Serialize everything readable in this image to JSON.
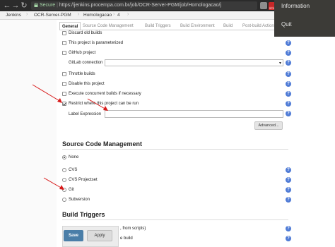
{
  "browser": {
    "secure_label": "Secure",
    "url_rest": "https://jenkins.procempa.com.br/job/OCR-Server-PGM/job/Homologacao/j",
    "ext_badge": "575"
  },
  "popup": {
    "items": [
      "Information",
      "Quit"
    ]
  },
  "breadcrumb": {
    "items": [
      "Jenkins",
      "OCR-Server-PGM",
      "Homologacao",
      "4"
    ]
  },
  "tabs": [
    "General",
    "Source Code Management",
    "Build Triggers",
    "Build Environment",
    "Build",
    "Post-build Actions"
  ],
  "general": {
    "discard_old_builds": "Discard old builds",
    "parameterized": "This project is parameterized",
    "github_project": "GitHub project",
    "gitlab_connection": "GitLab connection",
    "throttle_builds": "Throttle builds",
    "disable_project": "Disable this project",
    "concurrent_builds": "Execute concurrent builds if necessary",
    "restrict": "Restrict where this project can be run",
    "label_expression": "Label Expression",
    "advanced_button": "Advanced..."
  },
  "scm": {
    "title": "Source Code Management",
    "options": [
      "None",
      "CVS",
      "CVS Projectset",
      "Git",
      "Subversion"
    ],
    "selected": "None"
  },
  "triggers": {
    "title": "Build Triggers",
    "partial_text": ", from scripts)",
    "partial_text_2": "e build"
  },
  "footer": {
    "save": "Save",
    "apply": "Apply"
  },
  "colors": {
    "chrome_bg": "#2b2b2b",
    "help_blue": "#4f7bd6",
    "save_blue": "#4a7ea8",
    "arrow_red": "#d81b1b"
  }
}
